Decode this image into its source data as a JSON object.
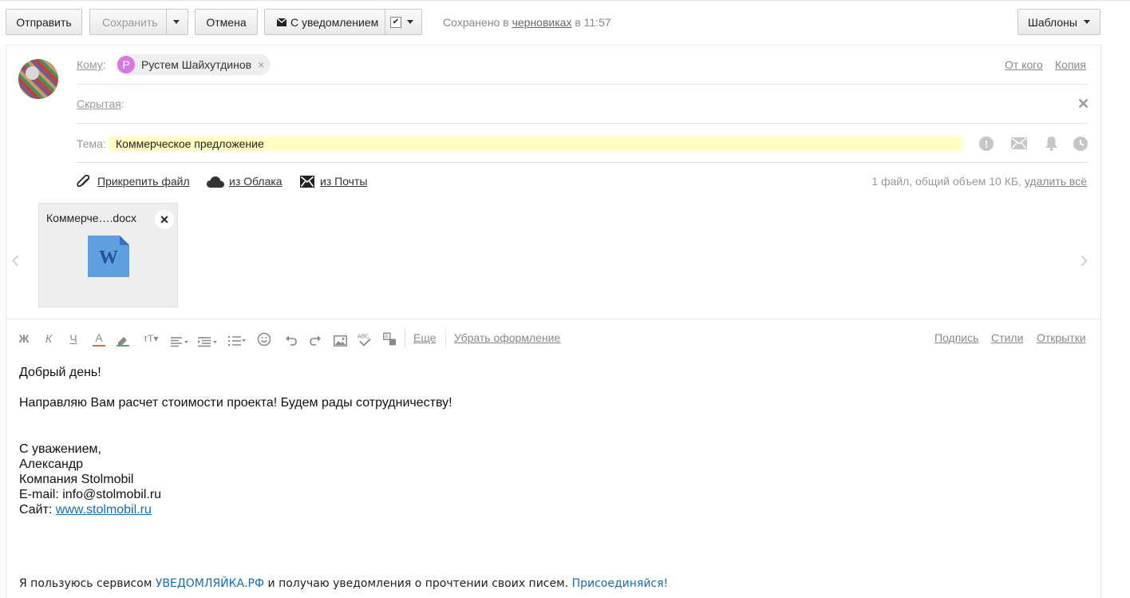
{
  "toolbar": {
    "send": "Отправить",
    "save": "Сохранить",
    "cancel": "Отмена",
    "notify": "С уведомлением",
    "templates": "Шаблоны"
  },
  "saved_status": {
    "prefix": "Сохранено в",
    "link": "черновиках",
    "suffix": "в 11:57"
  },
  "header": {
    "to_label": "Кому",
    "recipient_initial": "Р",
    "recipient_name": "Рустем Шайхутдинов",
    "from_link": "От кого",
    "copy_link": "Копия",
    "bcc_label": "Скрытая",
    "subject_label": "Тема:",
    "subject_value": "Коммерческое предложение"
  },
  "attachments": {
    "attach_file": "Прикрепить файл",
    "from_cloud": "из Облака",
    "from_mail": "из Почты",
    "summary": "1 файл, общий объем 10 КБ,",
    "delete_all": "удалить всё",
    "file_name": "Коммерче….docx"
  },
  "editor": {
    "more": "Еще",
    "clear_format": "Убрать оформление",
    "signature": "Подпись",
    "styles": "Стили",
    "cards": "Открытки"
  },
  "message": {
    "greeting": "Добрый день!",
    "line1": "Направляю Вам расчет стоимости проекта! Будем рады сотрудничеству!",
    "sig1": "С уважением,",
    "sig2": "Александр",
    "sig3": "Компания Stolmobil",
    "sig4": "E-mail: info@stolmobil.ru",
    "sig5_prefix": "Сайт:",
    "sig5_link": "www.stolmobil.ru",
    "footer_a": "Я пользуюсь сервисом",
    "footer_b": "УВЕДОМЛЯЙКА.РФ",
    "footer_c": "и получаю уведомления о прочтении своих писем.",
    "footer_d": "Присоединяйся!"
  },
  "colors": {
    "subject_bg": "#ffffc2",
    "avatar_chip": "#d778e0",
    "link_blue": "#1a6ab4",
    "word_icon": "#5e9fe0"
  }
}
